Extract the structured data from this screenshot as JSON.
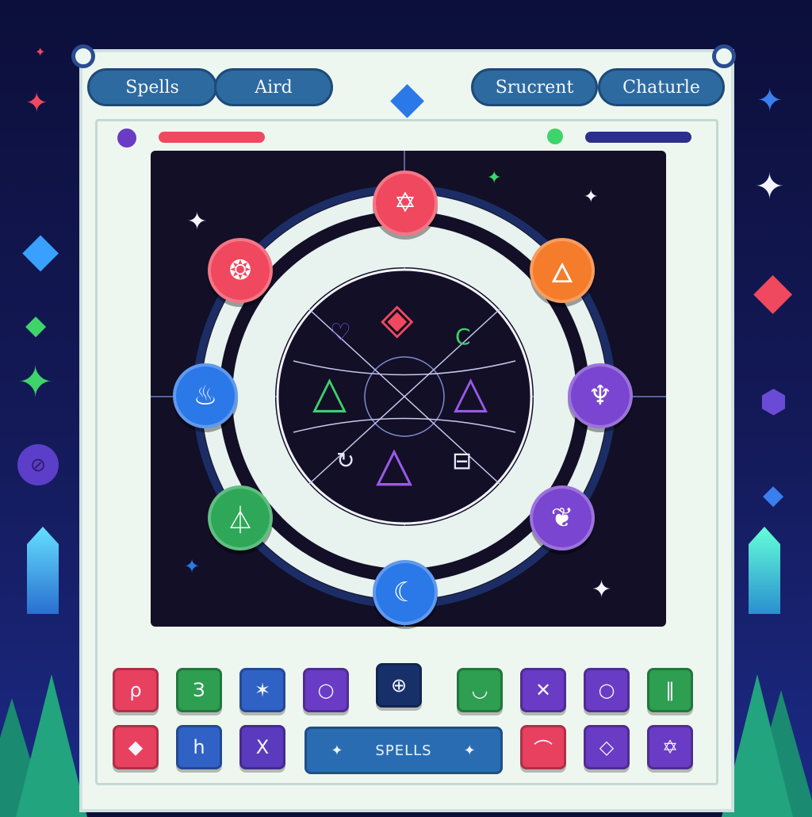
{
  "tabs": {
    "left": [
      {
        "label": "Spells"
      },
      {
        "label": "Aird"
      }
    ],
    "right": [
      {
        "label": "Srucrent"
      },
      {
        "label": "Chaturle"
      }
    ]
  },
  "meters": {
    "left": {
      "color": "#f0485e",
      "fraction": 0.6
    },
    "right": {
      "color": "#2d2f8c",
      "fraction": 0.75
    }
  },
  "nodes": [
    {
      "name": "node-top",
      "icon": "hexagram-icon",
      "glyph": "✡",
      "color": "#f0485e"
    },
    {
      "name": "node-top-left",
      "icon": "sun-wheel-icon",
      "glyph": "❂",
      "color": "#f0485e"
    },
    {
      "name": "node-top-right",
      "icon": "flame-icon",
      "glyph": "🜂",
      "color": "#f47c2a"
    },
    {
      "name": "node-left",
      "icon": "fire-icon",
      "glyph": "♨",
      "color": "#2b78e8"
    },
    {
      "name": "node-right",
      "icon": "dragon-icon",
      "glyph": "♆",
      "color": "#7a45d0"
    },
    {
      "name": "node-bottom-left",
      "icon": "triangle-eye-icon",
      "glyph": "⏃",
      "color": "#2ea858"
    },
    {
      "name": "node-bottom-right",
      "icon": "bird-icon",
      "glyph": "❦",
      "color": "#7a45d0"
    },
    {
      "name": "node-bottom",
      "icon": "moon-icon",
      "glyph": "☾",
      "color": "#2b78e8"
    }
  ],
  "spell_grid": {
    "row1": [
      {
        "glyph": "ρ",
        "icon": "rune-icon",
        "color": "#e8405f"
      },
      {
        "glyph": "З",
        "icon": "rune-icon",
        "color": "#2e9e50"
      },
      {
        "glyph": "✶",
        "icon": "star-icon",
        "color": "#2f62c4"
      },
      {
        "glyph": "○",
        "icon": "circle-icon",
        "color": "#6a3bc4"
      },
      {
        "glyph": "⊕",
        "icon": "crosshair-icon",
        "color": "#18306a"
      },
      {
        "glyph": "◡",
        "icon": "crescent-icon",
        "color": "#2e9e50"
      },
      {
        "glyph": "✕",
        "icon": "rune-icon",
        "color": "#6a3bc4"
      },
      {
        "glyph": "○",
        "icon": "circle-icon",
        "color": "#6a3bc4"
      },
      {
        "glyph": "‖",
        "icon": "pillars-icon",
        "color": "#2e9e50"
      }
    ],
    "row2": [
      {
        "glyph": "◆",
        "icon": "diamond-icon",
        "color": "#e8405f"
      },
      {
        "glyph": "h",
        "icon": "rune-icon",
        "color": "#2f62c4"
      },
      {
        "glyph": "X",
        "icon": "rune-icon",
        "color": "#5a3bbd"
      },
      {
        "glyph": "⌒",
        "icon": "arc-icon",
        "color": "#e8405f"
      },
      {
        "glyph": "◇",
        "icon": "diamond-icon",
        "color": "#6a3bc4"
      },
      {
        "glyph": "✡",
        "icon": "hexagram-icon",
        "color": "#6a3bc4"
      }
    ]
  },
  "spells_button": {
    "label": "SPELLS",
    "glyph_left": "✦",
    "glyph_right": "✦"
  },
  "center_symbols": [
    {
      "glyph": "♡",
      "icon": "heart-icon",
      "color": "#6a4bd6"
    },
    {
      "glyph": "◈",
      "icon": "crystal-icon",
      "color": "#f0485e"
    },
    {
      "glyph": "C",
      "icon": "cycle-icon",
      "color": "#3ecf6e"
    },
    {
      "glyph": "△",
      "icon": "triangle-icon",
      "color": "#3ecf6e"
    },
    {
      "glyph": "△",
      "icon": "triangle-icon",
      "color": "#9a5ae8"
    },
    {
      "glyph": "△",
      "icon": "triangle-icon",
      "color": "#9a5ae8"
    },
    {
      "glyph": "⊟",
      "icon": "box-icon",
      "color": "#e8e8ff"
    },
    {
      "glyph": "↻",
      "icon": "spiral-icon",
      "color": "#e8e8ff"
    }
  ]
}
